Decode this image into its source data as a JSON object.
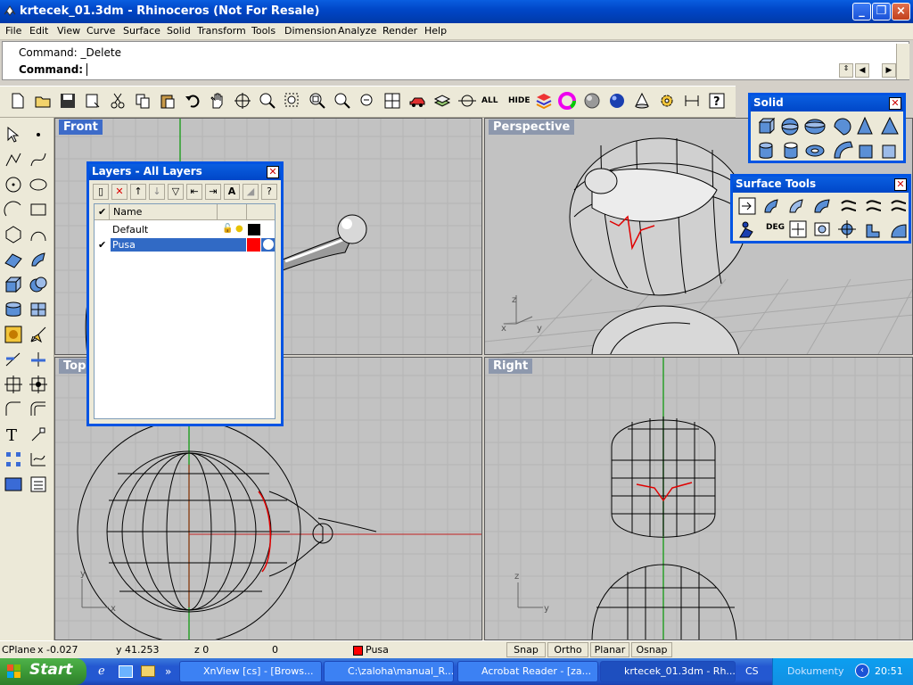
{
  "window": {
    "title": "krtecek_01.3dm - Rhinoceros (Not For Resale)"
  },
  "menu": [
    "File",
    "Edit",
    "View",
    "Curve",
    "Surface",
    "Solid",
    "Transform",
    "Tools",
    "Dimension",
    "Analyze",
    "Render",
    "Help"
  ],
  "command": {
    "history": "Command: _Delete",
    "prompt": "Command:"
  },
  "viewports": {
    "front": "Front",
    "perspective": "Perspective",
    "top": "Top",
    "right": "Right"
  },
  "layers_panel": {
    "title": "Layers - All Layers",
    "column_name": "Name",
    "layers": [
      {
        "name": "Default",
        "current": false,
        "color": "#000000"
      },
      {
        "name": "Pusa",
        "current": true,
        "color": "#ff0000"
      }
    ]
  },
  "solid_panel": {
    "title": "Solid"
  },
  "surface_panel": {
    "title": "Surface Tools"
  },
  "toolbar": {
    "all_label": "ALL",
    "hide_label": "HIDE",
    "deg_label": "DEG"
  },
  "status": {
    "cplane": "CPlane",
    "x": "x -0.027",
    "y": "y 41.253",
    "z": "z 0",
    "value": "0",
    "layer": "Pusa",
    "snap": "Snap",
    "ortho": "Ortho",
    "planar": "Planar",
    "osnap": "Osnap"
  },
  "taskbar": {
    "start": "Start",
    "tasks": [
      "XnView [cs] - [Brows...",
      "C:\\zaloha\\manual_R...",
      "Acrobat Reader - [za...",
      "krtecek_01.3dm - Rh..."
    ],
    "lang": "CS",
    "folder": "Dokumenty",
    "clock": "20:51"
  },
  "colors": {
    "accent": "#0054e3",
    "viewport_bg": "#c2c2c2",
    "selection": "#316ac5",
    "curve": "#ff0000"
  }
}
